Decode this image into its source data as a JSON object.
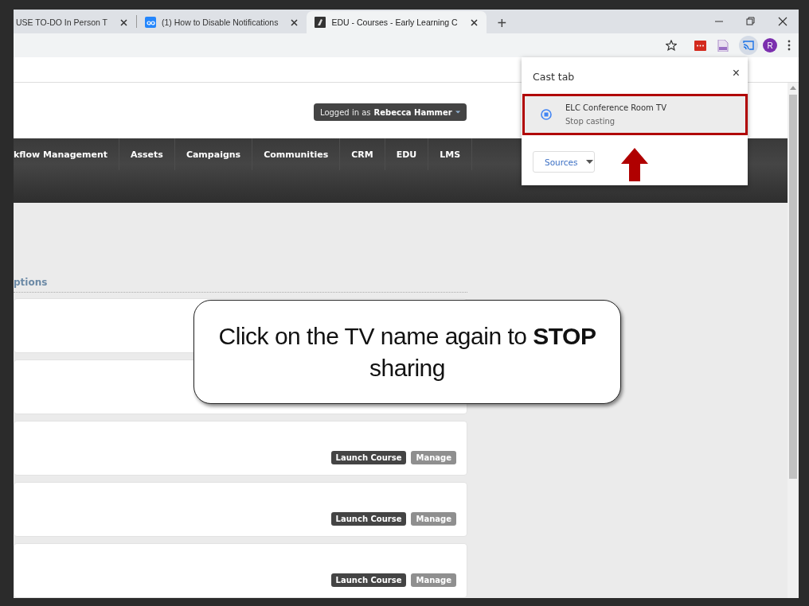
{
  "browser": {
    "tabs": [
      {
        "title": "USE TO-DO In Person T",
        "selected": false
      },
      {
        "title": "(1) How to Disable Notifications",
        "selected": false
      },
      {
        "title": "EDU - Courses - Early Learning C",
        "selected": true
      }
    ],
    "new_tab": "+",
    "profile_initial": "R",
    "cast_active": true
  },
  "page": {
    "user_menu": {
      "prefix": "Logged in as",
      "name": "Rebecca Hammer"
    },
    "nav": [
      "kflow Management",
      "Assets",
      "Campaigns",
      "Communities",
      "CRM",
      "EDU",
      "LMS"
    ],
    "section_heading": "ptions",
    "cards": [
      {
        "kind": "blank"
      },
      {
        "kind": "blank"
      },
      {
        "kind": "course",
        "buttons": [
          {
            "label": "Launch Course",
            "kind": "primary"
          },
          {
            "label": "Manage",
            "kind": "secondary"
          }
        ]
      },
      {
        "kind": "course",
        "buttons": [
          {
            "label": "Launch Course",
            "kind": "primary"
          },
          {
            "label": "Manage",
            "kind": "secondary"
          }
        ]
      },
      {
        "kind": "course",
        "buttons": [
          {
            "label": "Launch Course",
            "kind": "primary"
          },
          {
            "label": "Manage",
            "kind": "secondary"
          }
        ]
      }
    ]
  },
  "cast_popup": {
    "title": "Cast tab",
    "close": "×",
    "devices": [
      {
        "name": "ELC Conference Room TV",
        "status": "Stop casting",
        "highlighted": true
      }
    ],
    "sources_button": "Sources"
  },
  "callout": {
    "text": "Click on the TV name again to **STOP** sharing"
  }
}
